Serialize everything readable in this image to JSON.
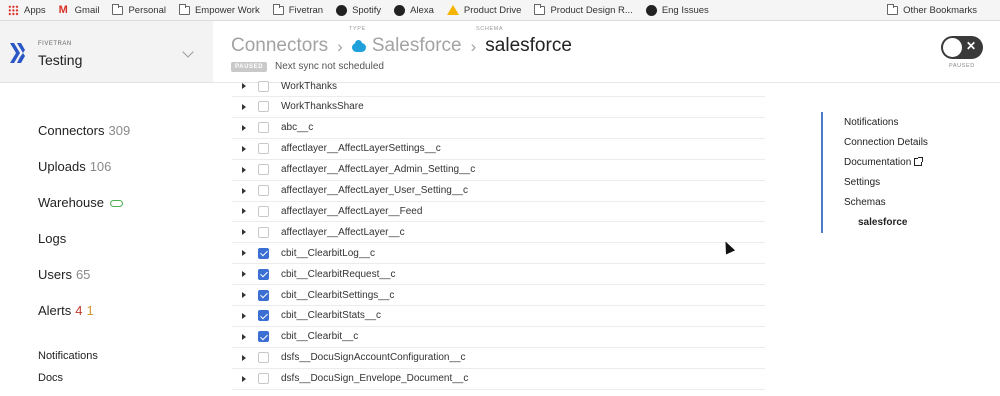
{
  "bookmarks": [
    {
      "label": "Apps",
      "icon": "apps-grid-icon"
    },
    {
      "label": "Gmail",
      "icon": "gmail-icon"
    },
    {
      "label": "Personal",
      "icon": "folder-icon"
    },
    {
      "label": "Empower Work",
      "icon": "folder-icon"
    },
    {
      "label": "Fivetran",
      "icon": "folder-icon"
    },
    {
      "label": "Spotify",
      "icon": "spotify-icon"
    },
    {
      "label": "Alexa",
      "icon": "github-icon"
    },
    {
      "label": "Product Drive",
      "icon": "google-drive-icon"
    },
    {
      "label": "Product Design R...",
      "icon": "folder-icon"
    },
    {
      "label": "Eng Issues",
      "icon": "github-icon"
    }
  ],
  "other_bookmarks": "Other Bookmarks",
  "account": {
    "label": "FIVETRAN",
    "name": "Testing"
  },
  "header": {
    "crumb1": "Connectors",
    "type_label": "TYPE",
    "crumb2": "Salesforce",
    "schema_label": "SCHEMA",
    "crumb3": "salesforce",
    "badge": "PAUSED",
    "sync_note": "Next sync not scheduled",
    "toggle_x": "✕",
    "toggle_label": "PAUSED"
  },
  "nav": {
    "connectors": "Connectors",
    "connectors_count": "309",
    "uploads": "Uploads",
    "uploads_count": "106",
    "warehouse": "Warehouse",
    "logs": "Logs",
    "users": "Users",
    "users_count": "65",
    "alerts": "Alerts",
    "alerts_count": "4",
    "alerts_warn": "1",
    "notifications": "Notifications",
    "docs": "Docs"
  },
  "tables": [
    {
      "name": "WorkThanks",
      "checked": false
    },
    {
      "name": "WorkThanksShare",
      "checked": false
    },
    {
      "name": "abc__c",
      "checked": false
    },
    {
      "name": "affectlayer__AffectLayerSettings__c",
      "checked": false
    },
    {
      "name": "affectlayer__AffectLayer_Admin_Setting__c",
      "checked": false
    },
    {
      "name": "affectlayer__AffectLayer_User_Setting__c",
      "checked": false
    },
    {
      "name": "affectlayer__AffectLayer__Feed",
      "checked": false
    },
    {
      "name": "affectlayer__AffectLayer__c",
      "checked": false
    },
    {
      "name": "cbit__ClearbitLog__c",
      "checked": true
    },
    {
      "name": "cbit__ClearbitRequest__c",
      "checked": true
    },
    {
      "name": "cbit__ClearbitSettings__c",
      "checked": true
    },
    {
      "name": "cbit__ClearbitStats__c",
      "checked": true
    },
    {
      "name": "cbit__Clearbit__c",
      "checked": true
    },
    {
      "name": "dsfs__DocuSignAccountConfiguration__c",
      "checked": false
    },
    {
      "name": "dsfs__DocuSign_Envelope_Document__c",
      "checked": false
    }
  ],
  "right_nav": {
    "notifications": "Notifications",
    "connection_details": "Connection Details",
    "documentation": "Documentation",
    "settings": "Settings",
    "schemas": "Schemas",
    "schema_salesforce": "salesforce"
  }
}
